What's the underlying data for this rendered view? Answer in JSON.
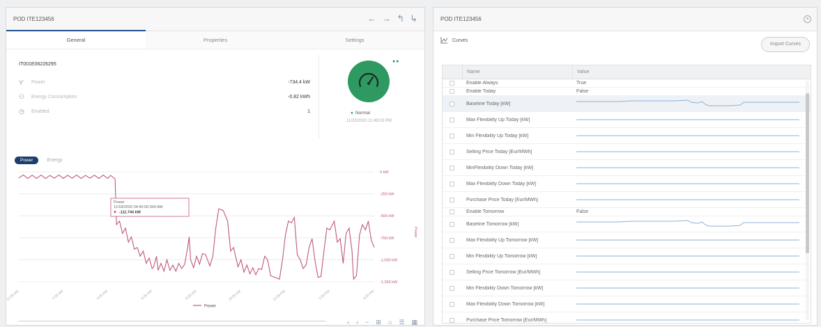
{
  "left_pane": {
    "title": "POD ITE123456",
    "nav_icons": [
      "arrow-left-icon",
      "arrow-right-icon",
      "arrow-up-icon",
      "share-icon"
    ],
    "tabs": [
      {
        "label": "General",
        "active": true
      },
      {
        "label": "Properties",
        "active": false
      },
      {
        "label": "Settings",
        "active": false
      }
    ],
    "device_id": "IT001E06226295",
    "properties": [
      {
        "icon": "plug-icon",
        "label": "Power",
        "value": "-734.4 kW"
      },
      {
        "icon": "energy-icon",
        "label": "Energy Consumption",
        "value": "-0.82 kWh"
      },
      {
        "icon": "clock-icon",
        "label": "Enabled",
        "value": "1"
      }
    ],
    "gauge": {
      "color": "#2e9a62",
      "icon": "speedometer-icon"
    },
    "status": {
      "label": "Normal",
      "timestamp": "11/23/2020 11:49:03 PM"
    },
    "chart_tabs": [
      {
        "label": "Power",
        "active": true
      },
      {
        "label": "Energy",
        "active": false
      }
    ],
    "bottom_tools": [
      "scroll-left-icon",
      "scroll-right-icon",
      "minus-icon",
      "zoom-icon",
      "home-icon",
      "menu-icon",
      "grid-icon"
    ]
  },
  "chart_data": {
    "type": "line",
    "series": [
      {
        "name": "Power",
        "color": "#c0577a",
        "points": [
          [
            0,
            -70
          ],
          [
            0.3,
            -35
          ],
          [
            0.6,
            -75
          ],
          [
            0.9,
            -38
          ],
          [
            1.2,
            -74
          ],
          [
            1.5,
            -36
          ],
          [
            1.8,
            -76
          ],
          [
            2.1,
            -40
          ],
          [
            2.4,
            -72
          ],
          [
            2.7,
            -35
          ],
          [
            3.0,
            -75
          ],
          [
            3.3,
            -38
          ],
          [
            3.6,
            -73
          ],
          [
            3.9,
            -36
          ],
          [
            4.2,
            -74
          ],
          [
            4.5,
            -40
          ],
          [
            4.8,
            -72
          ],
          [
            5.1,
            -38
          ],
          [
            5.4,
            -75
          ],
          [
            5.7,
            -36
          ],
          [
            6.0,
            -74
          ],
          [
            6.2,
            -40
          ],
          [
            6.5,
            -80
          ],
          [
            6.6,
            -600
          ],
          [
            6.8,
            -560
          ],
          [
            7.0,
            -700
          ],
          [
            7.2,
            -640
          ],
          [
            7.4,
            -800
          ],
          [
            7.6,
            -740
          ],
          [
            7.8,
            -880
          ],
          [
            8.0,
            -860
          ],
          [
            8.2,
            -960
          ],
          [
            8.4,
            -900
          ],
          [
            8.6,
            -1040
          ],
          [
            8.8,
            -980
          ],
          [
            9.0,
            -1100
          ],
          [
            9.1,
            -1080
          ],
          [
            9.3,
            -960
          ],
          [
            9.4,
            -1120
          ],
          [
            9.6,
            -1040
          ],
          [
            9.8,
            -1130
          ],
          [
            10.0,
            -1000
          ],
          [
            10.2,
            -1120
          ],
          [
            10.4,
            -1060
          ],
          [
            10.6,
            -1130
          ],
          [
            10.8,
            -1040
          ],
          [
            11.0,
            -1100
          ],
          [
            11.2,
            -1050
          ],
          [
            11.4,
            -860
          ],
          [
            11.5,
            -740
          ],
          [
            11.6,
            -1000
          ],
          [
            11.8,
            -1090
          ],
          [
            12.0,
            -960
          ],
          [
            12.2,
            -1050
          ],
          [
            12.4,
            -930
          ],
          [
            12.6,
            -940
          ],
          [
            12.9,
            -1070
          ],
          [
            13.1,
            -960
          ],
          [
            13.3,
            -640
          ],
          [
            13.5,
            -420
          ],
          [
            13.8,
            -440
          ],
          [
            14.1,
            -560
          ],
          [
            14.3,
            -900
          ],
          [
            14.5,
            -860
          ],
          [
            14.8,
            -1080
          ],
          [
            15.0,
            -1000
          ],
          [
            15.2,
            -1140
          ],
          [
            15.4,
            -1060
          ],
          [
            15.6,
            -1160
          ],
          [
            15.8,
            -1090
          ],
          [
            16.0,
            -1170
          ],
          [
            16.2,
            -1100
          ],
          [
            16.4,
            -1110
          ],
          [
            16.6,
            -960
          ],
          [
            16.8,
            -1000
          ],
          [
            17.0,
            -1180
          ],
          [
            17.3,
            -1200
          ],
          [
            17.6,
            -1220
          ],
          [
            17.8,
            -1000
          ],
          [
            18.0,
            -720
          ],
          [
            18.2,
            -560
          ],
          [
            18.4,
            -580
          ],
          [
            18.6,
            -520
          ],
          [
            18.8,
            -940
          ],
          [
            19.0,
            -1000
          ],
          [
            19.2,
            -1100
          ],
          [
            19.4,
            -1060
          ],
          [
            19.6,
            -860
          ],
          [
            19.8,
            -760
          ],
          [
            20.0,
            -1010
          ],
          [
            20.2,
            -1200
          ],
          [
            20.4,
            -1190
          ],
          [
            20.6,
            -900
          ],
          [
            20.8,
            -640
          ],
          [
            21.0,
            -660
          ],
          [
            21.3,
            -560
          ],
          [
            21.5,
            -800
          ],
          [
            21.7,
            -760
          ],
          [
            21.9,
            -1040
          ],
          [
            22.1,
            -700
          ],
          [
            22.3,
            -640
          ],
          [
            22.5,
            -900
          ],
          [
            22.6,
            -1220
          ],
          [
            22.8,
            -1180
          ],
          [
            23.0,
            -720
          ],
          [
            23.2,
            -600
          ],
          [
            23.4,
            -660
          ],
          [
            23.6,
            -560
          ],
          [
            23.8,
            -780
          ],
          [
            24.0,
            -860
          ]
        ]
      }
    ],
    "y_ticks": [
      "0 kW",
      "-250 kW",
      "-500 kW",
      "-750 kW",
      "-1,000 kW",
      "-1,250 kW"
    ],
    "y_values": [
      0,
      -250,
      -500,
      -750,
      -1000,
      -1250
    ],
    "ylabel": "Power",
    "x_ticks": [
      "12:00 AM",
      "2:00 AM",
      "4:00 AM",
      "6:00 AM",
      "8:00 AM",
      "10:00 AM",
      "12:00 PM",
      "2:00 PM",
      "4:00 PM"
    ],
    "legend": "Power",
    "tooltip": {
      "title": "Power",
      "time": "11/18/2020 04:40:00.000 AM",
      "value": "-111.744 kW"
    },
    "ylim": [
      -1250,
      0
    ],
    "xlim": [
      0,
      24
    ]
  },
  "right_pane": {
    "title": "POD ITE123456",
    "curves_label": "Curves",
    "import_label": "Import Curves",
    "columns": {
      "name": "Name",
      "value": "Value"
    },
    "rows": [
      {
        "name": "Enable Always",
        "value": "True",
        "type": "text",
        "size": "short"
      },
      {
        "name": "Enable Today",
        "value": "False",
        "type": "text",
        "size": "short"
      },
      {
        "name": "Baseline Today [kW]",
        "type": "spark",
        "size": "tall",
        "highlight": true,
        "shape": "dip"
      },
      {
        "name": "Max Flexibility Up Today [kW]",
        "type": "spark",
        "size": "tall",
        "shape": "flat"
      },
      {
        "name": "Min Flexibility Up Today [kW]",
        "type": "spark",
        "size": "tall",
        "shape": "flat"
      },
      {
        "name": "Selling Price Today [Eur/MWh]",
        "type": "spark",
        "size": "tall",
        "shape": "flat"
      },
      {
        "name": "MinFlexibility Down Today [kW]",
        "type": "spark",
        "size": "tall",
        "shape": "flat"
      },
      {
        "name": "Max Flexibility Down Today [kW]",
        "type": "spark",
        "size": "tall",
        "shape": "flat"
      },
      {
        "name": "Purchase Price Today [Eur/MWh]",
        "type": "spark",
        "size": "tall",
        "shape": "flat"
      },
      {
        "name": "Enable Tomorrow",
        "value": "False",
        "type": "text",
        "size": "short"
      },
      {
        "name": "Baseline Tomorrow [kW]",
        "type": "spark",
        "size": "tall",
        "shape": "dip"
      },
      {
        "name": "Max Flexibility Up Tomorrow [kW]",
        "type": "spark",
        "size": "tall",
        "shape": "flat"
      },
      {
        "name": "Min Flexibility Up Tomorrow [kW]",
        "type": "spark",
        "size": "tall",
        "shape": "flat"
      },
      {
        "name": "Selling Price Tomorrow [Eur/MWh]",
        "type": "spark",
        "size": "tall",
        "shape": "flat"
      },
      {
        "name": "Min Flexibility Down Tomorrow [kW]",
        "type": "spark",
        "size": "tall",
        "shape": "flat"
      },
      {
        "name": "Max Flexibility Down Tomorrow [kW]",
        "type": "spark",
        "size": "tall",
        "shape": "flat"
      },
      {
        "name": "Purchase Price Tomorrow [Eur/MWh]",
        "type": "spark",
        "size": "tall",
        "shape": "flat"
      }
    ]
  }
}
